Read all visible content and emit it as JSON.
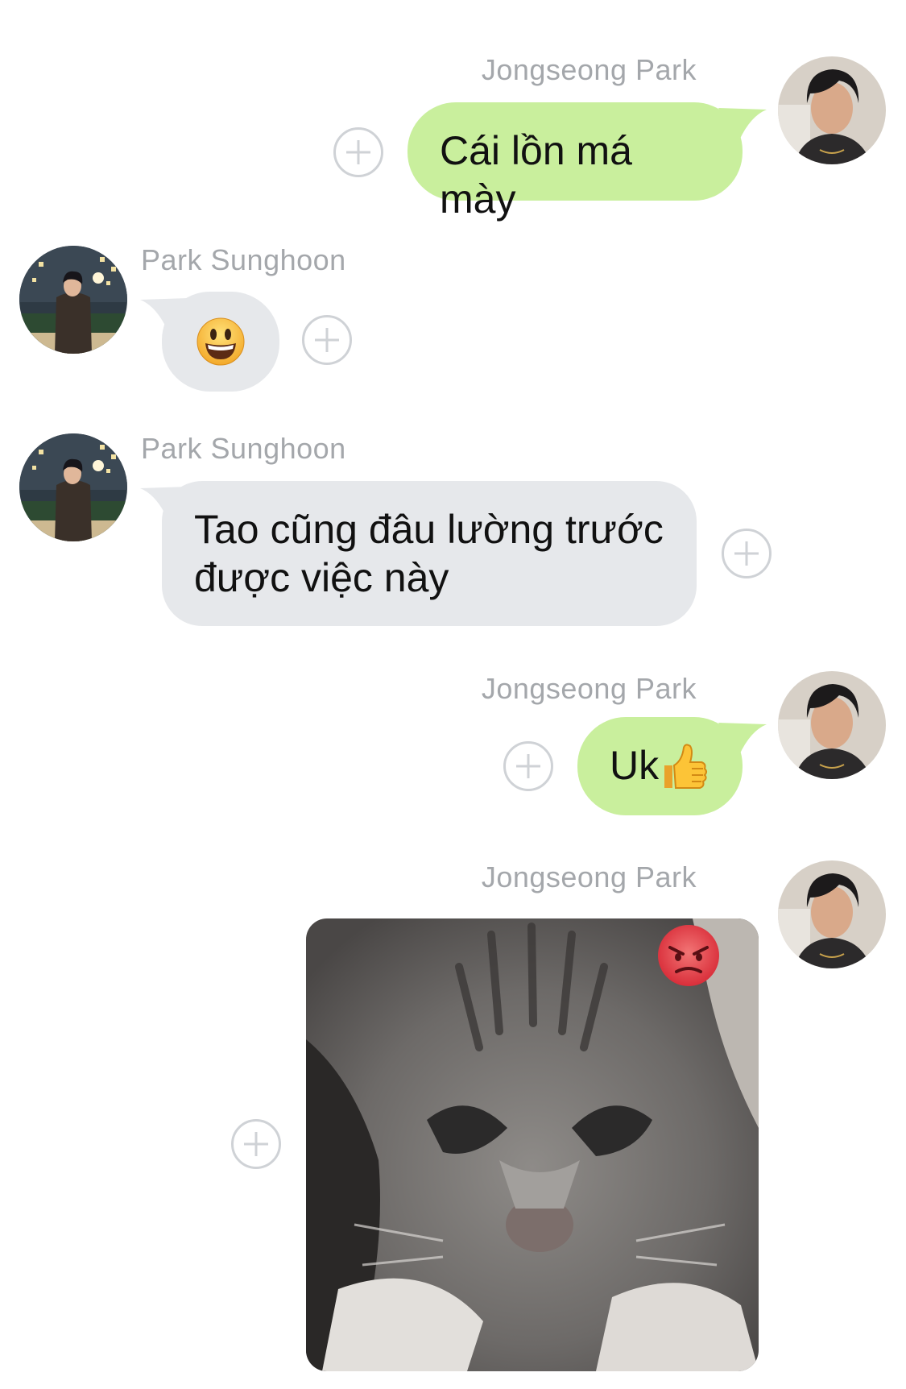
{
  "participants": {
    "jongseong": {
      "name": "Jongseong Park",
      "avatar_icon": "person-portrait-avatar"
    },
    "sunghoon": {
      "name": "Park Sunghoon",
      "avatar_icon": "person-night-city-avatar"
    }
  },
  "colors": {
    "outgoing_bubble": "#c9ef9d",
    "incoming_bubble": "#e6e8eb",
    "sender_name": "#a4a7ab",
    "add_reaction": "#cfd2d6"
  },
  "messages": [
    {
      "sender": "Jongseong Park",
      "text": "Cái lồn má mày"
    },
    {
      "sender": "Park Sunghoon",
      "emoji": "grinning-face-emoji"
    },
    {
      "sender": "Park Sunghoon",
      "line1": "Tao cũng đâu lường trước",
      "line2": "được việc này"
    },
    {
      "sender": "Jongseong Park",
      "text": "Uk",
      "emoji": "thumbs-up-emoji"
    },
    {
      "sender": "Jongseong Park",
      "image": "angry-kitten-photo",
      "sticker": "pouting-face-emoji"
    }
  ],
  "add_reaction_icon": "plus-circle-icon"
}
